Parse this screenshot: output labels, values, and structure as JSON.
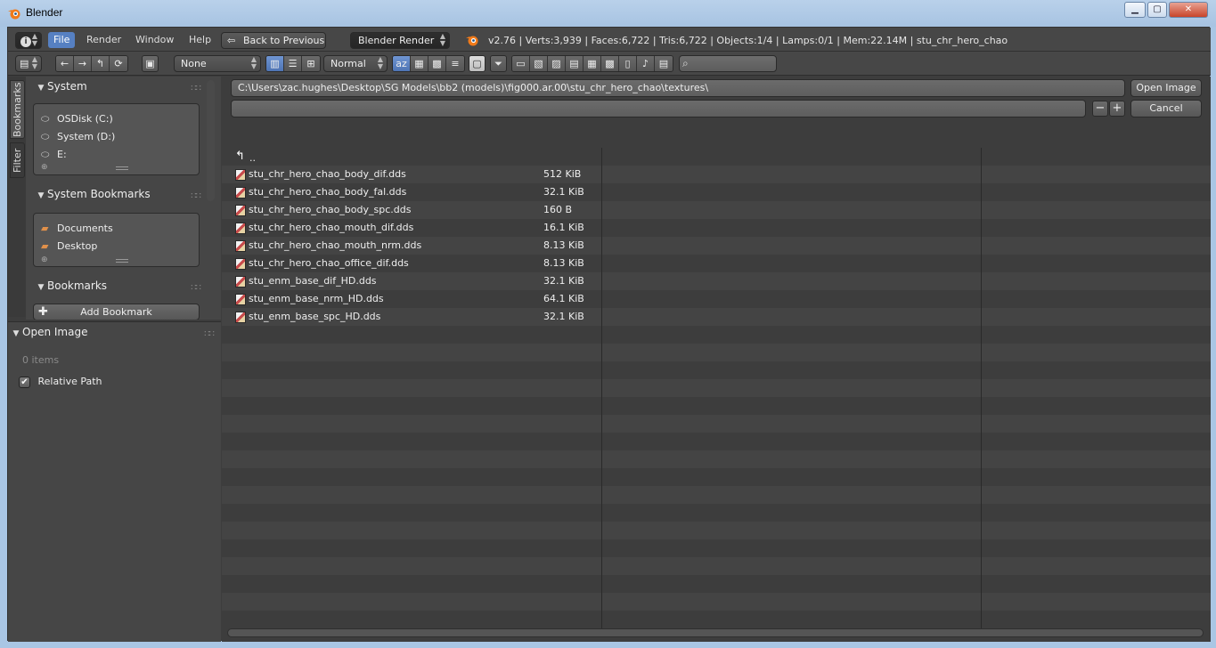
{
  "window": {
    "title": "Blender",
    "minimize": "▁",
    "maximize": "▢",
    "close": "✕"
  },
  "info_header": {
    "editor_icon": "i",
    "menus": {
      "file": "File",
      "render": "Render",
      "window": "Window",
      "help": "Help"
    },
    "back_button": "Back to Previous",
    "render_engine": "Blender Render",
    "stats": "v2.76 | Verts:3,939 | Faces:6,722 | Tris:6,722 | Objects:1/4 | Lamps:0/1 | Mem:22.14M | stu_chr_hero_chao"
  },
  "file_toolbar": {
    "recursion": "None",
    "thumbnail_size": "Normal",
    "search_value": ""
  },
  "vertical_tabs": {
    "bookmarks": "Bookmarks",
    "filter": "Filter"
  },
  "sidebar": {
    "system_header": "System",
    "system_items": [
      "OSDisk (C:)",
      "System (D:)",
      "E:"
    ],
    "system_bookmarks_header": "System Bookmarks",
    "system_bookmarks": [
      "Documents",
      "Desktop"
    ],
    "bookmarks_header": "Bookmarks",
    "add_bookmark": "Add Bookmark"
  },
  "operator": {
    "header": "Open Image",
    "items_count": "0 items",
    "relative_path_label": "Relative Path",
    "relative_path_checked": true
  },
  "main": {
    "directory_path": "C:\\Users\\zac.hughes\\Desktop\\SG Models\\bb2 (models)\\fig000.ar.00\\stu_chr_hero_chao\\textures\\",
    "filename_value": "",
    "open_button": "Open Image",
    "cancel_button": "Cancel",
    "minus": "−",
    "plus": "+",
    "parent_dir": "..",
    "files": [
      {
        "name": "stu_chr_hero_chao_body_dif.dds",
        "size": "512 KiB"
      },
      {
        "name": "stu_chr_hero_chao_body_fal.dds",
        "size": "32.1 KiB"
      },
      {
        "name": "stu_chr_hero_chao_body_spc.dds",
        "size": "160 B"
      },
      {
        "name": "stu_chr_hero_chao_mouth_dif.dds",
        "size": "16.1 KiB"
      },
      {
        "name": "stu_chr_hero_chao_mouth_nrm.dds",
        "size": "8.13 KiB"
      },
      {
        "name": "stu_chr_hero_chao_office_dif.dds",
        "size": "8.13 KiB"
      },
      {
        "name": "stu_enm_base_dif_HD.dds",
        "size": "32.1 KiB"
      },
      {
        "name": "stu_enm_base_nrm_HD.dds",
        "size": "64.1 KiB"
      },
      {
        "name": "stu_enm_base_spc_HD.dds",
        "size": "32.1 KiB"
      }
    ]
  },
  "colors": {
    "accent": "#5680c2",
    "background": "#3d3d3d",
    "panel": "#464646",
    "titlebar": "#b9d1ea"
  }
}
